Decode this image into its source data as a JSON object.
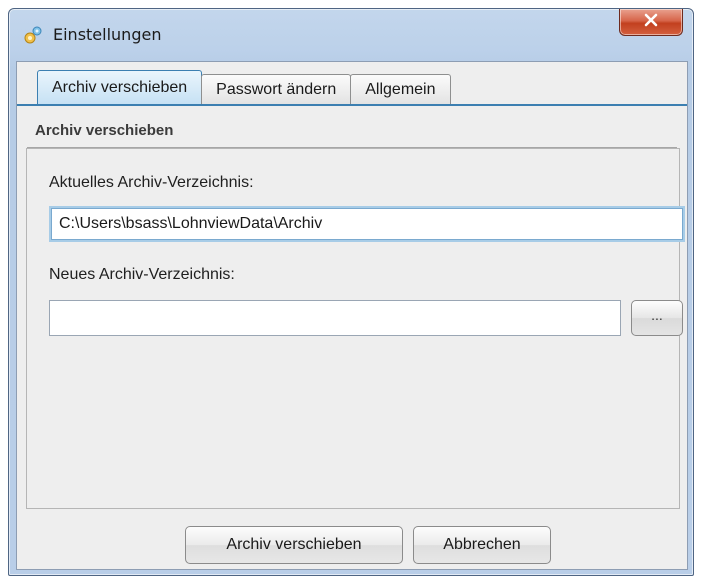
{
  "window": {
    "title": "Einstellungen",
    "icon": "settings-app-icon",
    "close_icon": "close-icon"
  },
  "tabs": [
    {
      "label": "Archiv verschieben",
      "active": true
    },
    {
      "label": "Passwort ändern",
      "active": false
    },
    {
      "label": "Allgemein",
      "active": false
    }
  ],
  "panel": {
    "title": "Archiv verschieben",
    "current_label": "Aktuelles Archiv-Verzeichnis:",
    "current_value": "C:\\Users\\bsass\\LohnviewData\\Archiv",
    "new_label": "Neues Archiv-Verzeichnis:",
    "new_value": "",
    "browse_label": "..."
  },
  "buttons": {
    "move_label": "Archiv verschieben",
    "cancel_label": "Abbrechen"
  },
  "colors": {
    "accent": "#3c7fb1",
    "close": "#c2401f"
  }
}
